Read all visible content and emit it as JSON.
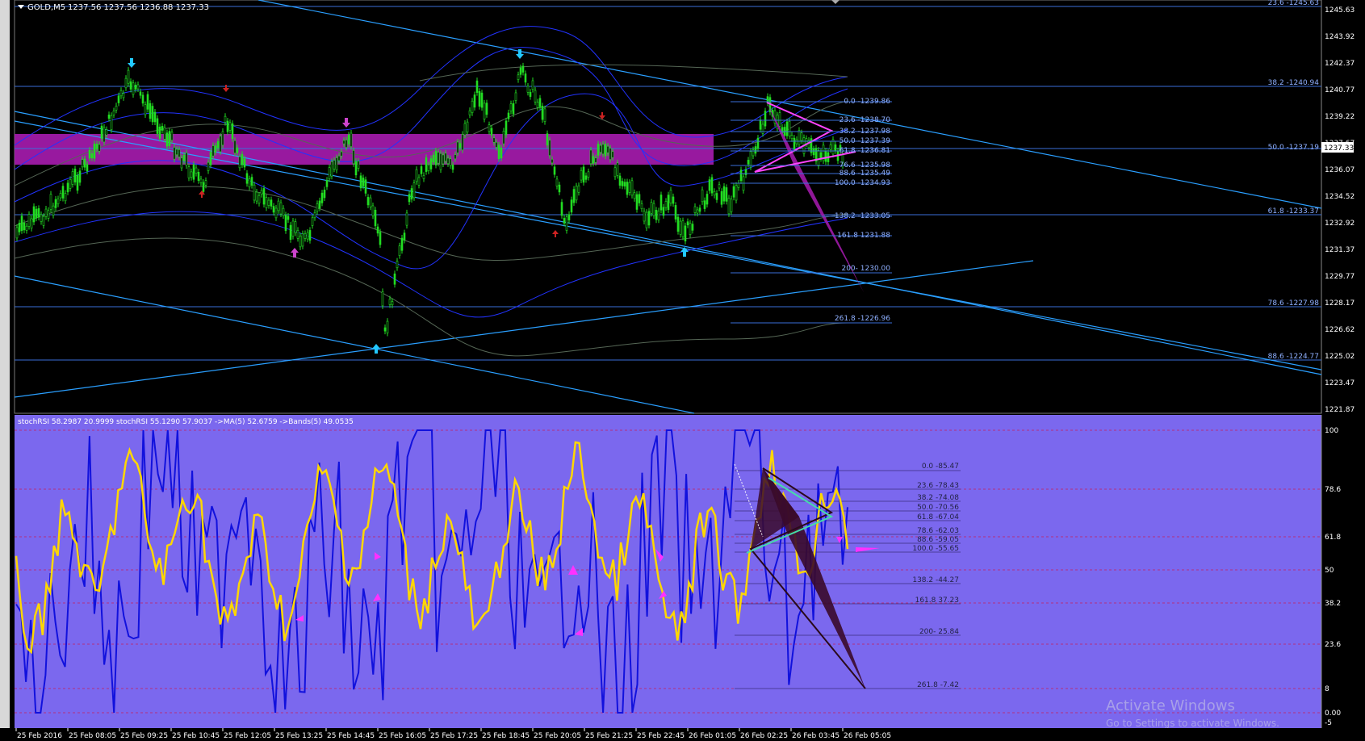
{
  "main": {
    "symbol_label": "GOLD,M5",
    "ohlc": "1237.56 1237.56 1236.88 1237.33",
    "price_axis": [
      "1245.63",
      "1243.92",
      "1242.37",
      "1240.77",
      "1239.22",
      "1237.67",
      "1236.07",
      "1234.52",
      "1232.92",
      "1231.37",
      "1229.77",
      "1228.17",
      "1226.62",
      "1225.02",
      "1223.47",
      "1221.87"
    ],
    "current_price": "1237.33",
    "fib_right": [
      "23.6 -1245.63",
      "38.2 -1240.94",
      "50.0 -1237.19",
      "61.8 -1233.37",
      "78.6 -1227.98",
      "88.6 -1224.77"
    ],
    "fib_pattern": [
      "0.0 -1239.86",
      "23.6 -1238.70",
      "38.2 -1237.98",
      "50.0 -1237.39",
      "61.8 -1236.81",
      "76.6 -1235.98",
      "88.6 -1235.49",
      "100.0 -1234.93",
      "138.2 -1233.05",
      "161.8 1231.88",
      "200- 1230.00",
      "261.8 -1226.96"
    ]
  },
  "oscillator": {
    "header": "stochRSI 58.2987 20.9999  stochRSI 55.1290 57.9037  ->MA(5) 52.6759  ->Bands(5) 49.0535",
    "axis": [
      "100",
      "78.6",
      "61.8",
      "50",
      "38.2",
      "23.6",
      "8",
      "0.00",
      "-5"
    ],
    "fib_labels": [
      "0.0 -85.47",
      "23.6 -78.43",
      "38.2 -74.08",
      "50.0 -70.56",
      "61.8 -67.04",
      "78.6 -62.03",
      "88.6 -59.05",
      "100.0 -55.65",
      "138.2 -44.27",
      "161.8 37.23",
      "200- 25.84",
      "261.8 -7.42"
    ]
  },
  "time_axis": [
    "25 Feb 2016",
    "25 Feb 08:05",
    "25 Feb 09:25",
    "25 Feb 10:45",
    "25 Feb 12:05",
    "25 Feb 13:25",
    "25 Feb 14:45",
    "25 Feb 16:05",
    "25 Feb 17:25",
    "25 Feb 18:45",
    "25 Feb 20:05",
    "25 Feb 21:25",
    "25 Feb 22:45",
    "26 Feb 01:05",
    "26 Feb 02:25",
    "26 Feb 03:45",
    "26 Feb 05:05"
  ],
  "watermark": {
    "title": "Activate Windows",
    "subtitle": "Go to Settings to activate Windows."
  },
  "colors": {
    "background": "#000000",
    "candle_up": "#22dd22",
    "osc_bg": "#7b68ee",
    "stoch_blue": "#1111dd",
    "stoch_yellow": "#ffd700",
    "zone": "#a01aa8",
    "grid_line": "#3a6ed8"
  }
}
